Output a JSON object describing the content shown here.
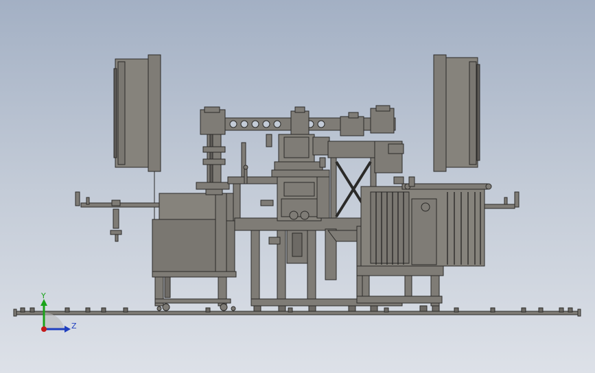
{
  "viewport": {
    "background_top": "#a3b0c4",
    "background_bottom": "#dde1e8"
  },
  "model": {
    "fill_color": "#7f7c76",
    "line_color": "#2b2a28",
    "panel_color": "#86837c"
  },
  "triad": {
    "y_label": "Y",
    "z_label": "Z",
    "y_color": "#1aa31a",
    "z_color": "#1f3fbf",
    "origin_color": "#c41a1a"
  }
}
